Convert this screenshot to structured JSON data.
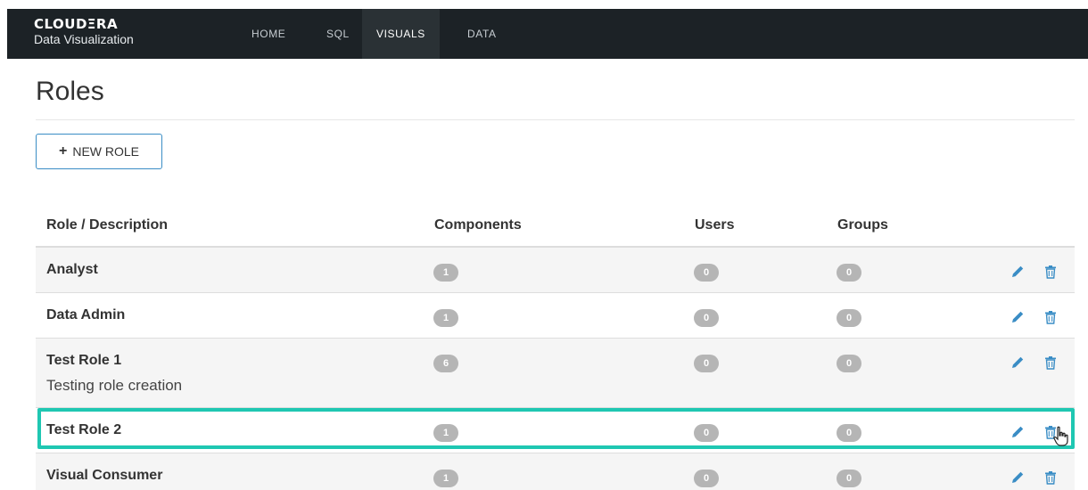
{
  "brand": {
    "name": "CLOUDΞRA",
    "subtitle": "Data Visualization"
  },
  "nav": [
    {
      "label": "HOME",
      "active": false
    },
    {
      "label": "SQL",
      "active": false
    },
    {
      "label": "VISUALS",
      "active": true
    },
    {
      "label": "DATA",
      "active": false
    }
  ],
  "page": {
    "title": "Roles"
  },
  "toolbar": {
    "new_role_label": "NEW ROLE",
    "new_role_icon": "plus-icon"
  },
  "table": {
    "headers": {
      "role": "Role / Description",
      "components": "Components",
      "users": "Users",
      "groups": "Groups"
    },
    "rows": [
      {
        "name": "Analyst",
        "description": "",
        "components": "1",
        "users": "0",
        "groups": "0"
      },
      {
        "name": "Data Admin",
        "description": "",
        "components": "1",
        "users": "0",
        "groups": "0"
      },
      {
        "name": "Test Role 1",
        "description": "Testing role creation",
        "components": "6",
        "users": "0",
        "groups": "0"
      },
      {
        "name": "Test Role 2",
        "description": "",
        "components": "1",
        "users": "0",
        "groups": "0",
        "highlighted": true
      },
      {
        "name": "Visual Consumer",
        "description": "",
        "components": "1",
        "users": "0",
        "groups": "0"
      }
    ],
    "row_actions": [
      "pencil-icon",
      "trash-icon"
    ]
  },
  "colors": {
    "topbar": "#1c2226",
    "accent": "#3a8dc5",
    "highlight": "#1fc7b2",
    "badge": "#b5b5b5",
    "stripe": "#f5f5f5"
  }
}
